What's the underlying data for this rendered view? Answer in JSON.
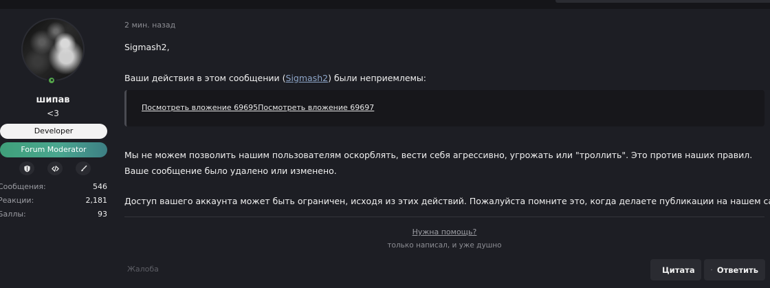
{
  "user": {
    "name": "шипав",
    "title": "<3",
    "banners": [
      "Developer",
      "Forum Moderator"
    ],
    "badge_icons": [
      "shield-icon",
      "code-icon",
      "brush-icon"
    ],
    "stats": [
      {
        "label": "Сообщения:",
        "value": "546"
      },
      {
        "label": "Реакции:",
        "value": "2,181"
      },
      {
        "label": "Баллы:",
        "value": "93"
      }
    ]
  },
  "message": {
    "time": "2 мин. назад",
    "greeting": "Sigmash2,",
    "p1_before": "Ваши действия в этом сообщении (",
    "p1_link": "Sigmash2",
    "p1_after": ") были неприемлемы:",
    "quote_link": "Посмотреть вложение 69695Посмотреть вложение 69697",
    "p2": "Мы не можем позволить нашим пользователям оскорблять, вести себя агрессивно, угрожать или \"троллить\". Это против наших правил. Ваше сообщение было удалено или изменено.",
    "p3": "Доступ вашего аккаунта может быть ограничен, исходя из этих действий. Пожалуйста помните это, когда делаете публикации на нашем сайте.",
    "help_link": "Нужна помощь?",
    "signature": "только написал, и уже душно"
  },
  "actions": {
    "report": "Жалоба",
    "quote": "Цитата",
    "reply": "Ответить"
  },
  "colors": {
    "background": "#1d1e24",
    "link": "#8ea6c9",
    "online": "#54a44a",
    "moderator_banner": "#46a585"
  }
}
